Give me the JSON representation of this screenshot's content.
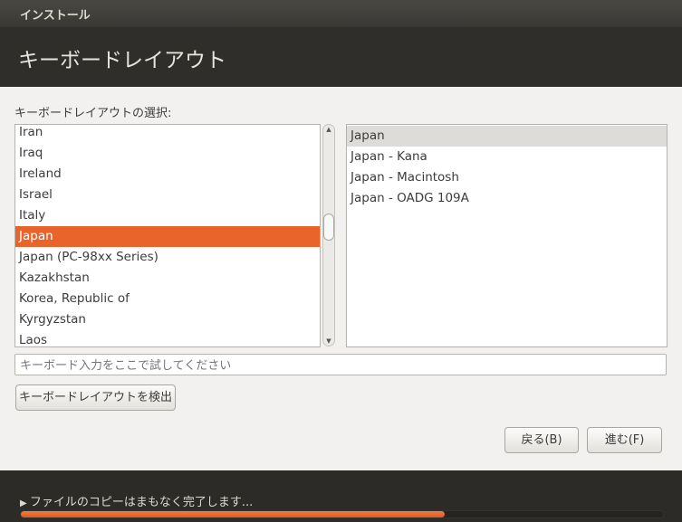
{
  "window": {
    "title": "インストール"
  },
  "header": {
    "title": "キーボードレイアウト"
  },
  "layout_label": "キーボードレイアウトの選択:",
  "layouts": [
    "Iran",
    "Iraq",
    "Ireland",
    "Israel",
    "Italy",
    "Japan",
    "Japan (PC-98xx Series)",
    "Kazakhstan",
    "Korea, Republic of",
    "Kyrgyzstan",
    "Laos"
  ],
  "selected_layout": "Japan",
  "variants": [
    "Japan",
    "Japan - Kana",
    "Japan - Macintosh",
    "Japan - OADG 109A"
  ],
  "test_input": {
    "placeholder": "キーボード入力をここで試してください",
    "value": ""
  },
  "detect_button": "キーボードレイアウトを検出",
  "back_button": "戻る(B)",
  "next_button": "進む(F)",
  "footer": {
    "status": "ファイルのコピーはまもなく完了します...",
    "progress_percent": 66
  },
  "colors": {
    "accent": "#e8642b"
  }
}
